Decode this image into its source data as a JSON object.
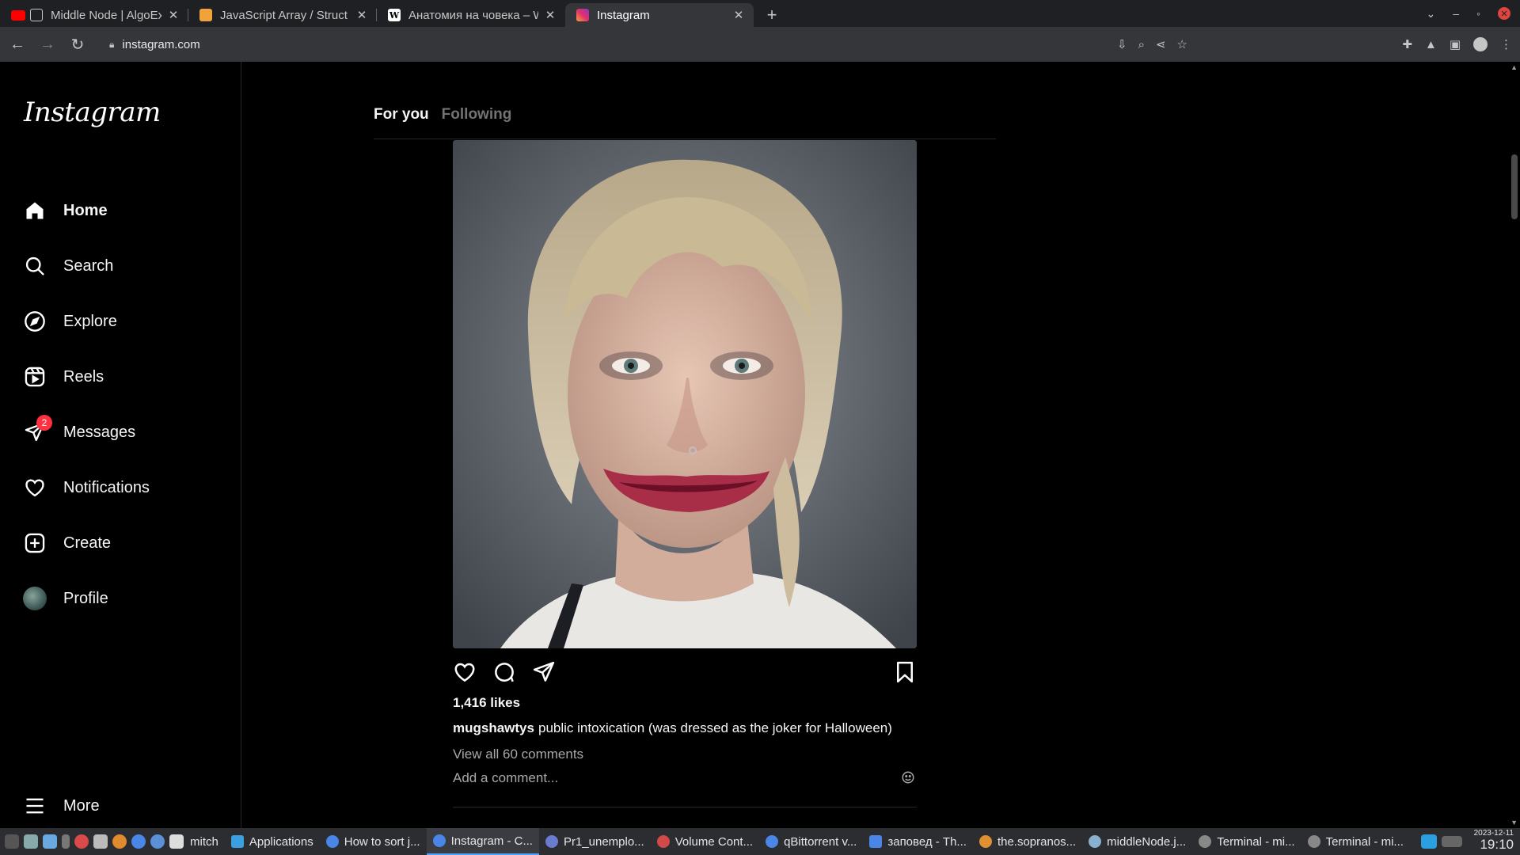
{
  "browser": {
    "tabs": [
      {
        "title": "Middle Node | AlgoExpert",
        "favicon": "algoexpert-icon",
        "color": "#ffffff"
      },
      {
        "title": "JavaScript Array / Struct",
        "favicon": "js-icon",
        "color": "#f0a33a"
      },
      {
        "title": "Анатомия на човека – W",
        "favicon": "wikipedia-icon",
        "color": "#ffffff"
      },
      {
        "title": "Instagram",
        "favicon": "instagram-icon",
        "color": "#e1306c",
        "active": true
      }
    ],
    "url": "instagram.com"
  },
  "instagram": {
    "logo": "Instagram",
    "nav": {
      "home": "Home",
      "search": "Search",
      "explore": "Explore",
      "reels": "Reels",
      "messages": "Messages",
      "messages_badge": "2",
      "notifications": "Notifications",
      "create": "Create",
      "profile": "Profile",
      "more": "More"
    },
    "feed_tabs": {
      "for_you": "For you",
      "following": "Following"
    },
    "post": {
      "likes": "1,416 likes",
      "username": "mugshawtys",
      "caption": "public intoxication (was dressed as the joker for Halloween)",
      "view_comments": "View all 60 comments",
      "comment_placeholder": "Add a comment..."
    }
  },
  "taskbar": {
    "user": "mitch",
    "tasks": [
      {
        "label": "Applications",
        "color": "#3aa0e0"
      },
      {
        "label": "How to sort j...",
        "color": "#4a86e8"
      },
      {
        "label": "Instagram - C...",
        "color": "#4a86e8",
        "active": true
      },
      {
        "label": "Pr1_unemplo...",
        "color": "#6a7cd0"
      },
      {
        "label": "Volume Cont...",
        "color": "#d04a4a"
      },
      {
        "label": "qBittorrent v...",
        "color": "#4a86e8"
      },
      {
        "label": "заповед - Th...",
        "color": "#4a86e8"
      },
      {
        "label": "the.sopranos...",
        "color": "#e09030"
      },
      {
        "label": "middleNode.j...",
        "color": "#8ab0d0"
      },
      {
        "label": "Terminal - mi...",
        "color": "#888888"
      },
      {
        "label": "Terminal - mi...",
        "color": "#888888"
      }
    ],
    "date": "2023-12-11",
    "time": "19:10"
  }
}
